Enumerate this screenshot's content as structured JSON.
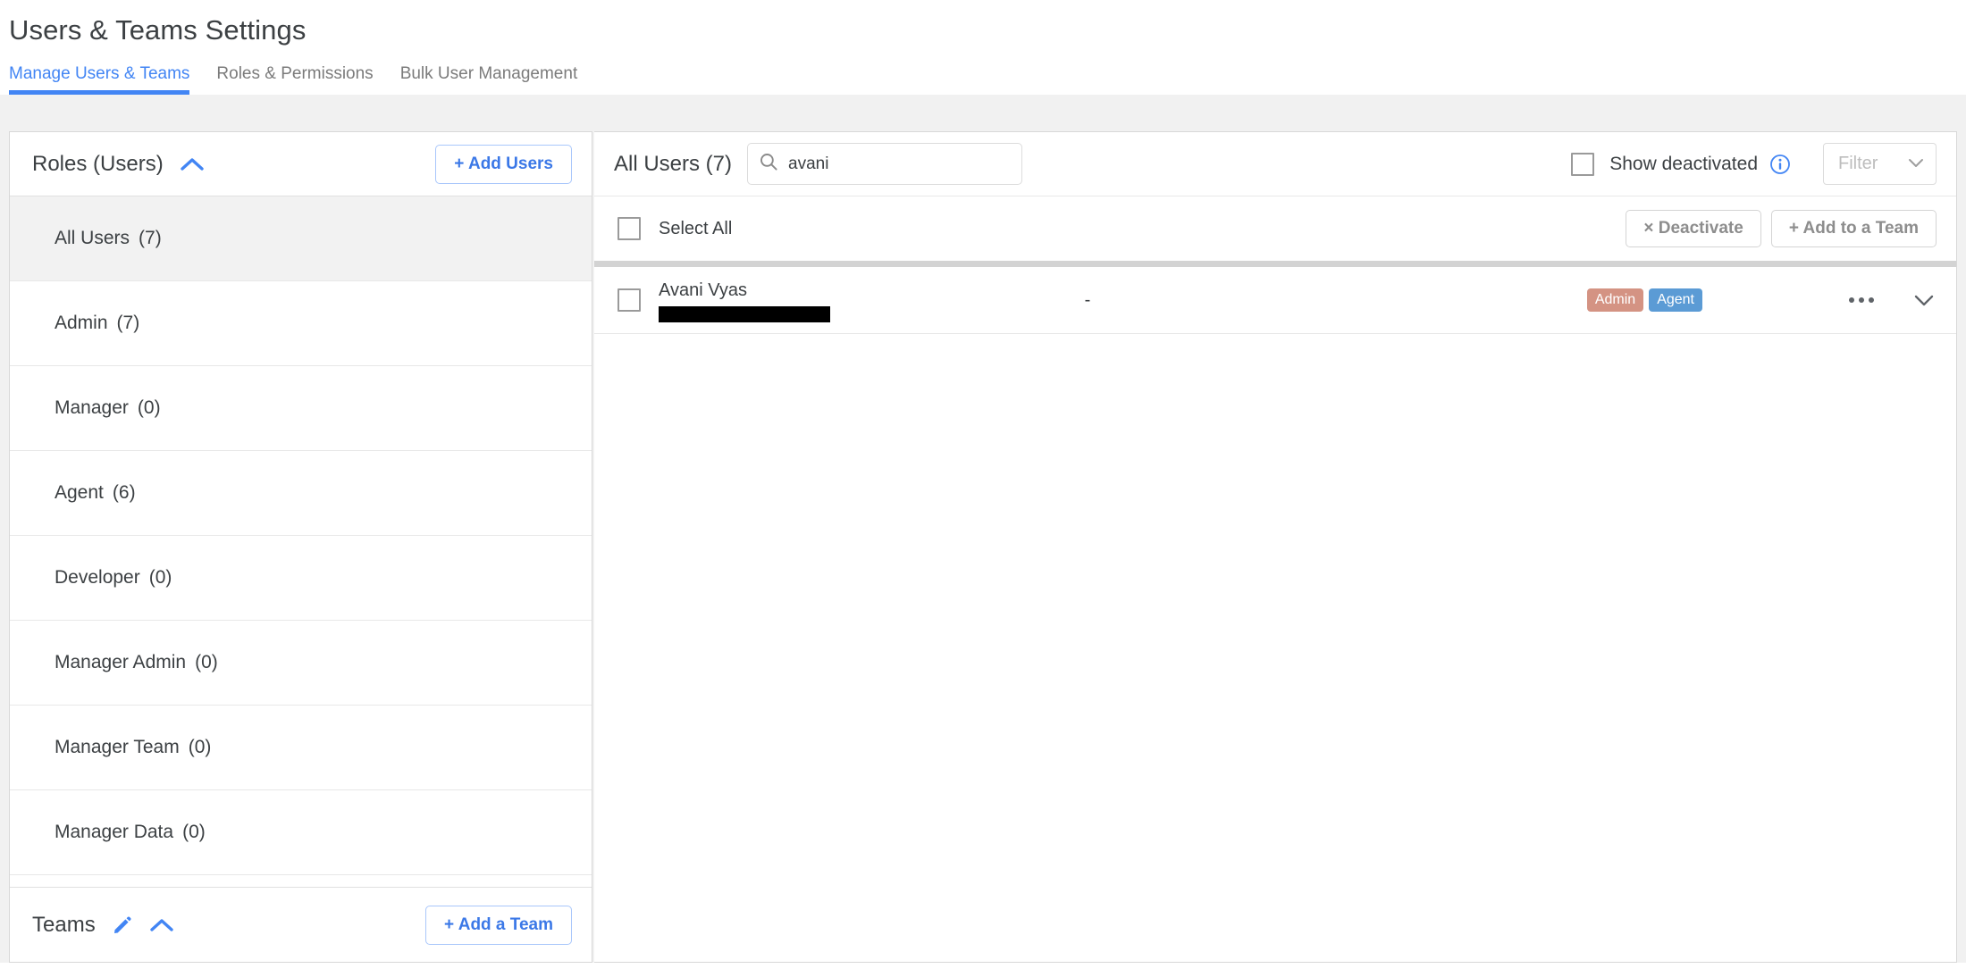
{
  "page": {
    "title": "Users & Teams Settings"
  },
  "tabs": [
    {
      "label": "Manage Users & Teams",
      "active": true
    },
    {
      "label": "Roles & Permissions",
      "active": false
    },
    {
      "label": "Bulk User Management",
      "active": false
    }
  ],
  "left_panel": {
    "roles_title": "Roles (Users)",
    "collapse_icon": "chevron-up-icon",
    "add_users_label": "+ Add Users",
    "roles": [
      {
        "label": "All Users",
        "count": "(7)",
        "selected": true
      },
      {
        "label": "Admin",
        "count": "(7)",
        "selected": false
      },
      {
        "label": "Manager",
        "count": "(0)",
        "selected": false
      },
      {
        "label": "Agent",
        "count": "(6)",
        "selected": false
      },
      {
        "label": "Developer",
        "count": "(0)",
        "selected": false
      },
      {
        "label": "Manager Admin",
        "count": "(0)",
        "selected": false
      },
      {
        "label": "Manager Team",
        "count": "(0)",
        "selected": false
      },
      {
        "label": "Manager Data",
        "count": "(0)",
        "selected": false
      }
    ],
    "teams_title": "Teams",
    "teams_edit_icon": "pencil-icon",
    "teams_collapse_icon": "chevron-up-icon",
    "add_team_label": "+ Add a Team"
  },
  "right_panel": {
    "users_title": "All Users (7)",
    "search": {
      "icon": "search-icon",
      "value": "avani",
      "placeholder": "Search"
    },
    "show_deactivated_label": "Show deactivated",
    "info_icon": "info-icon",
    "filter_label": "Filter",
    "filter_chevron": "chevron-down-icon",
    "toolbar": {
      "select_all_label": "Select All",
      "deactivate_label": "× Deactivate",
      "add_to_team_label": "+ Add to a Team"
    },
    "users": [
      {
        "name": "Avani Vyas",
        "email_redacted": true,
        "team": "-",
        "badges": [
          {
            "label": "Admin",
            "color": "#d49383"
          },
          {
            "label": "Agent",
            "color": "#5b9bd5"
          }
        ],
        "menu_icon": "kebab-menu-icon",
        "expand_icon": "chevron-down-icon"
      }
    ]
  },
  "colors": {
    "accent": "#4285f4",
    "link": "#3b78e7",
    "text": "#3c4043",
    "muted": "#7b7b7b",
    "band": "#f1f1f1",
    "selected_row": "#f2f2f2",
    "divider": "#d3d3d3"
  }
}
